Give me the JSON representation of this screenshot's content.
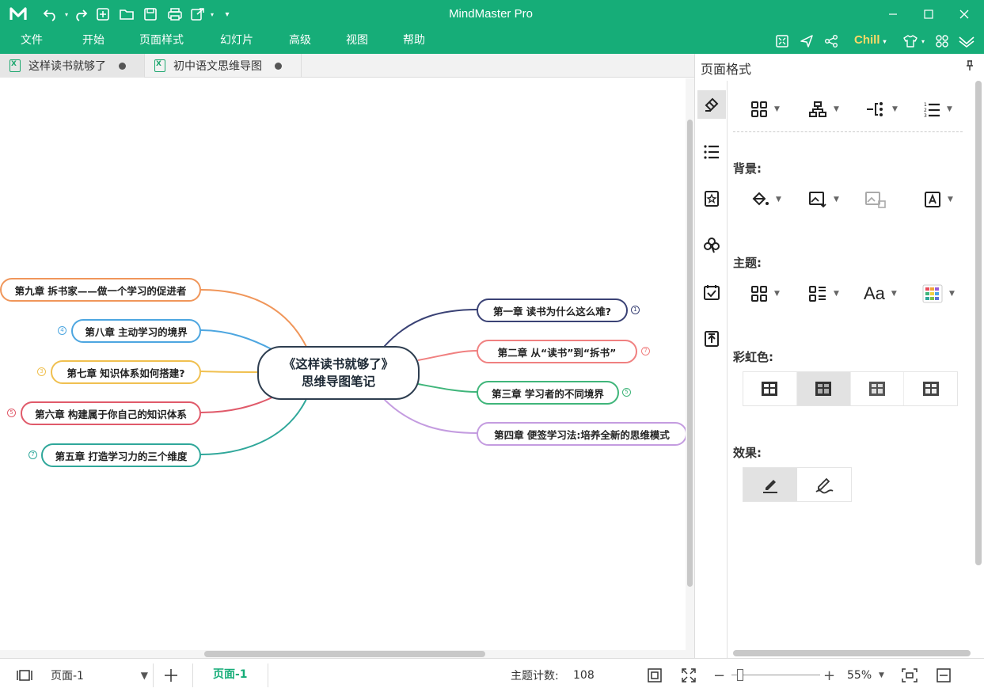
{
  "app": {
    "title": "MindMaster Pro"
  },
  "menu": {
    "items": [
      "文件",
      "开始",
      "页面样式",
      "幻灯片",
      "高级",
      "视图",
      "帮助"
    ],
    "theme_label": "Chill"
  },
  "tabs": [
    {
      "label": "这样读书就够了"
    },
    {
      "label": "初中语文思维导图"
    }
  ],
  "mindmap": {
    "central": {
      "line1": "《这样读书就够了》",
      "line2": "思维导图笔记"
    },
    "branches": [
      {
        "label": "第一章 读书为什么这么难?",
        "color": "#3a4275",
        "badge": "1"
      },
      {
        "label": "第二章 从“读书”到“拆书”",
        "color": "#f08080",
        "badge": "7"
      },
      {
        "label": "第三章 学习者的不同境界",
        "color": "#3fb57a",
        "badge": "5"
      },
      {
        "label": "第四章 便签学习法:培养全新的思维模式",
        "color": "#c49ce0",
        "badge": ""
      },
      {
        "label": "第五章 打造学习力的三个维度",
        "color": "#2fa79a",
        "badge": "7"
      },
      {
        "label": "第六章 构建属于你自己的知识体系",
        "color": "#e05a6a",
        "badge": "5"
      },
      {
        "label": "第七章 知识体系如何搭建?",
        "color": "#f0c050",
        "badge": "3"
      },
      {
        "label": "第八章 主动学习的境界",
        "color": "#4da6e0",
        "badge": "4"
      },
      {
        "label": "第九章 拆书家——做一个学习的促进者",
        "color": "#f0965a",
        "badge": ""
      }
    ]
  },
  "panel": {
    "title": "页面格式",
    "sections": {
      "background": "背景:",
      "theme": "主题:",
      "rainbow": "彩虹色:",
      "effect": "效果:"
    },
    "theme_font_label": "Aa"
  },
  "status": {
    "page_select": "页面-1",
    "page_tab": "页面-1",
    "topic_count_label": "主题计数:",
    "topic_count": "108",
    "zoom": "55%",
    "zoom_level_fraction": 0.1
  },
  "colors": {
    "brand": "#16ad78",
    "chill": "#ffd966"
  }
}
